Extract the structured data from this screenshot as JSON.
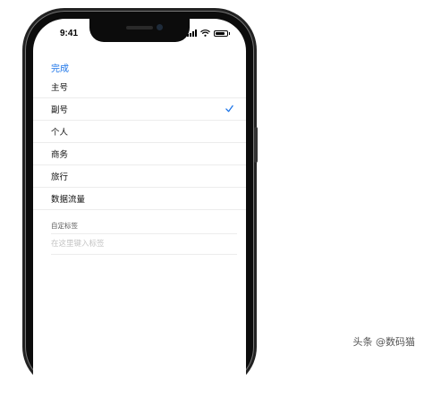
{
  "status_bar": {
    "time": "9:41"
  },
  "nav": {
    "done_label": "完成"
  },
  "labels": [
    {
      "text": "主号",
      "selected": false
    },
    {
      "text": "副号",
      "selected": true
    },
    {
      "text": "个人",
      "selected": false
    },
    {
      "text": "商务",
      "selected": false
    },
    {
      "text": "旅行",
      "selected": false
    },
    {
      "text": "数据流量",
      "selected": false
    }
  ],
  "custom": {
    "header": "自定标签",
    "placeholder": "在这里键入标签"
  },
  "accent_color": "#1a73e8",
  "watermark": "头条 @数码猫"
}
